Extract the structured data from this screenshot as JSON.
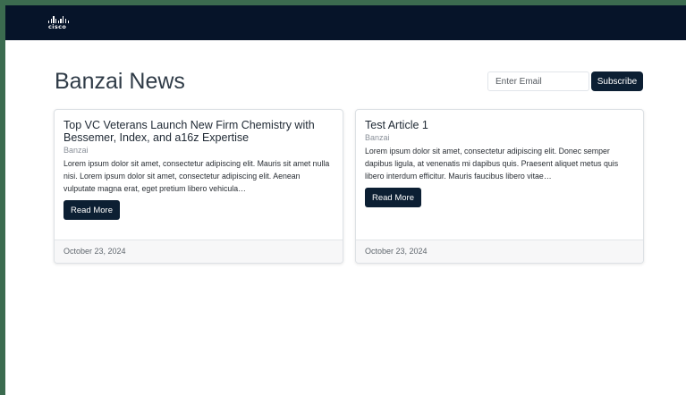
{
  "header": {
    "logo_text": "cisco",
    "brand_color": "#061429"
  },
  "page": {
    "title": "Banzai News"
  },
  "subscribe": {
    "email_placeholder": "Enter Email",
    "email_value": "",
    "button_label": "Subscribe"
  },
  "articles": [
    {
      "title": "Top VC Veterans Launch New Firm Chemistry with Bessemer, Index, and a16z Expertise",
      "author": "Banzai",
      "excerpt": "Lorem ipsum dolor sit amet, consectetur adipiscing elit. Mauris sit amet nulla nisi. Lorem ipsum dolor sit amet, consectetur adipiscing elit. Aenean vulputate magna erat, eget pretium libero vehicula…",
      "button_label": "Read More",
      "date": "October 23, 2024"
    },
    {
      "title": "Test Article 1",
      "author": "Banzai",
      "excerpt": "Lorem ipsum dolor sit amet, consectetur adipiscing elit. Donec semper dapibus ligula, at venenatis mi dapibus quis. Praesent aliquet metus quis libero interdum efficitur. Mauris faucibus libero vitae…",
      "button_label": "Read More",
      "date": "October 23, 2024"
    }
  ],
  "colors": {
    "accent": "#0c1f33",
    "frame": "#3b6b4f"
  }
}
